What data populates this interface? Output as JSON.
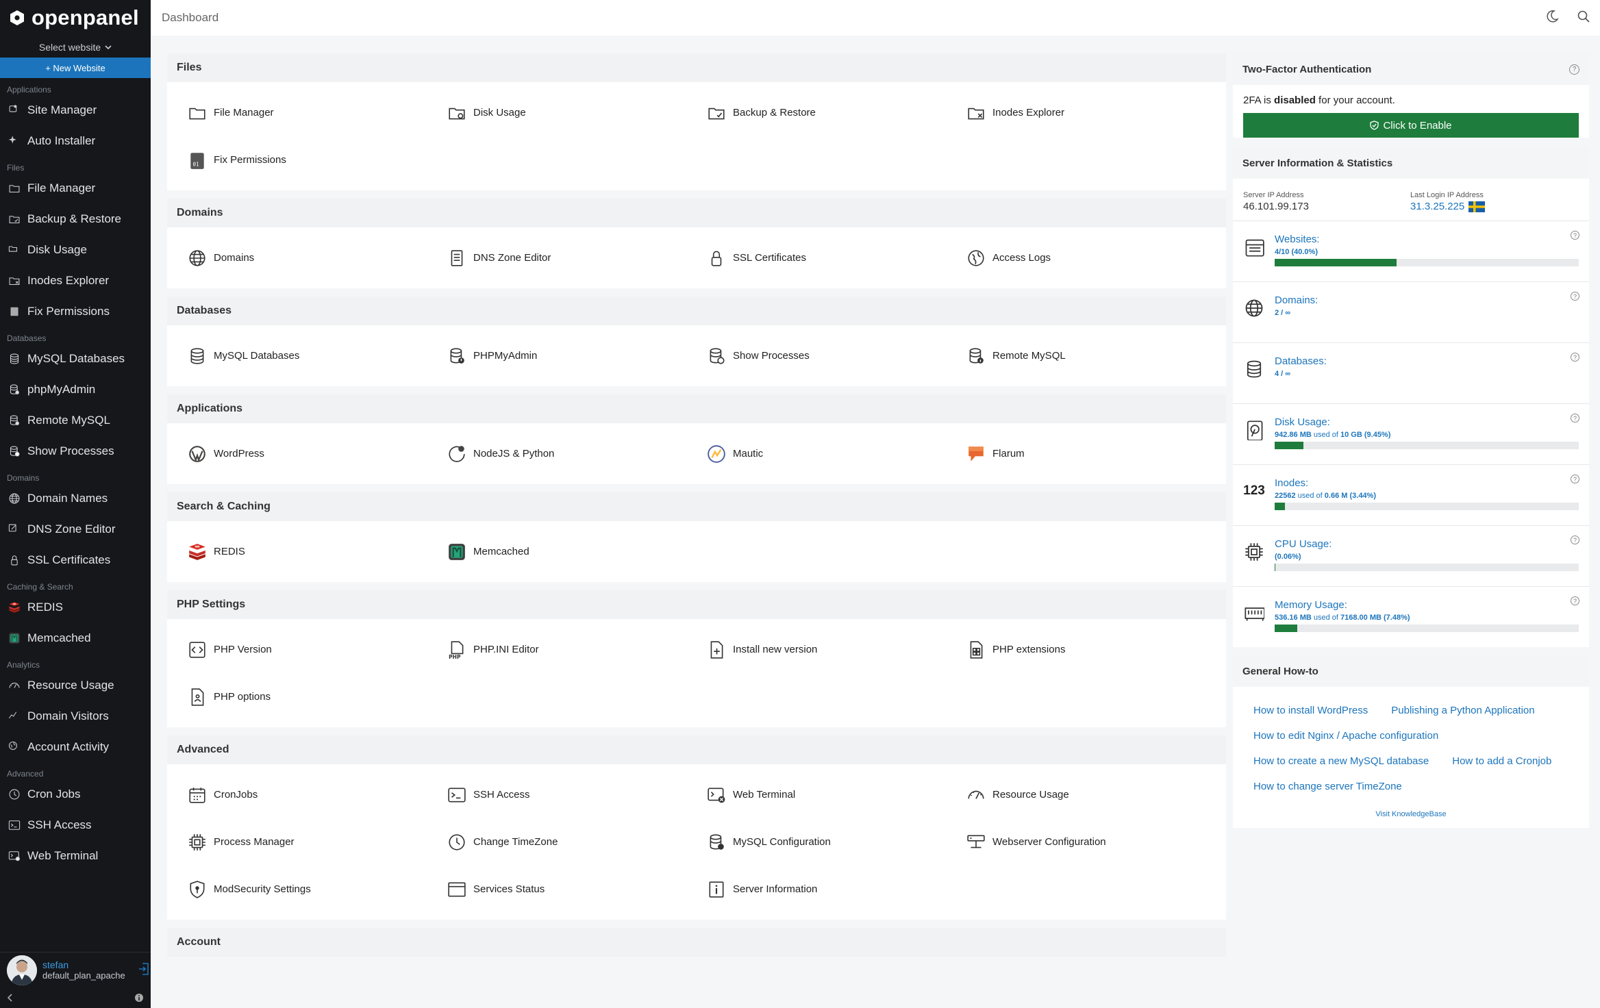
{
  "app": {
    "brand": "openpanel",
    "page_title": "Dashboard"
  },
  "sidebar": {
    "select_website": "Select website",
    "new_website": "+ New Website",
    "sections": [
      {
        "title": "Applications",
        "items": [
          {
            "label": "Site Manager",
            "icon": "site-icon"
          },
          {
            "label": "Auto Installer",
            "icon": "sparkle-icon"
          }
        ]
      },
      {
        "title": "Files",
        "items": [
          {
            "label": "File Manager",
            "icon": "folder-icon"
          },
          {
            "label": "Backup & Restore",
            "icon": "backup-icon"
          },
          {
            "label": "Disk Usage",
            "icon": "disk-icon"
          },
          {
            "label": "Inodes Explorer",
            "icon": "inodes-icon"
          },
          {
            "label": "Fix Permissions",
            "icon": "permissions-icon"
          }
        ]
      },
      {
        "title": "Databases",
        "items": [
          {
            "label": "MySQL Databases",
            "icon": "database-icon"
          },
          {
            "label": "phpMyAdmin",
            "icon": "phpmyadmin-icon"
          },
          {
            "label": "Remote MySQL",
            "icon": "remote-mysql-icon"
          },
          {
            "label": "Show Processes",
            "icon": "processes-icon"
          }
        ]
      },
      {
        "title": "Domains",
        "items": [
          {
            "label": "Domain Names",
            "icon": "globe-icon"
          },
          {
            "label": "DNS Zone Editor",
            "icon": "edit-icon"
          },
          {
            "label": "SSL Certificates",
            "icon": "lock-icon"
          }
        ]
      },
      {
        "title": "Caching & Search",
        "items": [
          {
            "label": "REDIS",
            "icon": "redis-icon"
          },
          {
            "label": "Memcached",
            "icon": "memcached-icon"
          }
        ]
      },
      {
        "title": "Analytics",
        "items": [
          {
            "label": "Resource Usage",
            "icon": "gauge-icon"
          },
          {
            "label": "Domain Visitors",
            "icon": "chart-icon"
          },
          {
            "label": "Account Activity",
            "icon": "activity-icon"
          }
        ]
      },
      {
        "title": "Advanced",
        "items": [
          {
            "label": "Cron Jobs",
            "icon": "clock-icon"
          },
          {
            "label": "SSH Access",
            "icon": "terminal-icon"
          },
          {
            "label": "Web Terminal",
            "icon": "web-terminal-icon"
          }
        ]
      }
    ],
    "user": {
      "name": "stefan",
      "plan": "default_plan_apache"
    }
  },
  "sections": [
    {
      "title": "Files",
      "tiles": [
        {
          "label": "File Manager",
          "icon": "folder-icon"
        },
        {
          "label": "Disk Usage",
          "icon": "disk-usage-icon"
        },
        {
          "label": "Backup & Restore",
          "icon": "backup-icon"
        },
        {
          "label": "Inodes Explorer",
          "icon": "inodes-icon"
        },
        {
          "label": "Fix Permissions",
          "icon": "fix-permissions-icon"
        }
      ]
    },
    {
      "title": "Domains",
      "tiles": [
        {
          "label": "Domains",
          "icon": "globe-icon"
        },
        {
          "label": "DNS Zone Editor",
          "icon": "dns-icon"
        },
        {
          "label": "SSL Certificates",
          "icon": "lock-icon"
        },
        {
          "label": "Access Logs",
          "icon": "access-logs-icon"
        }
      ]
    },
    {
      "title": "Databases",
      "tiles": [
        {
          "label": "MySQL Databases",
          "icon": "database-icon"
        },
        {
          "label": "PHPMyAdmin",
          "icon": "phpmyadmin-icon"
        },
        {
          "label": "Show Processes",
          "icon": "processes-icon"
        },
        {
          "label": "Remote MySQL",
          "icon": "remote-mysql-icon"
        }
      ]
    },
    {
      "title": "Applications",
      "tiles": [
        {
          "label": "WordPress",
          "icon": "wordpress-icon"
        },
        {
          "label": "NodeJS & Python",
          "icon": "nodejs-icon"
        },
        {
          "label": "Mautic",
          "icon": "mautic-icon"
        },
        {
          "label": "Flarum",
          "icon": "flarum-icon"
        }
      ]
    },
    {
      "title": "Search & Caching",
      "tiles": [
        {
          "label": "REDIS",
          "icon": "redis-icon"
        },
        {
          "label": "Memcached",
          "icon": "memcached-icon"
        }
      ]
    },
    {
      "title": "PHP Settings",
      "tiles": [
        {
          "label": "PHP Version",
          "icon": "code-icon"
        },
        {
          "label": "PHP.INI Editor",
          "icon": "php-ini-icon"
        },
        {
          "label": "Install new version",
          "icon": "install-icon"
        },
        {
          "label": "PHP extensions",
          "icon": "extensions-icon"
        },
        {
          "label": "PHP options",
          "icon": "options-icon"
        }
      ]
    },
    {
      "title": "Advanced",
      "tiles": [
        {
          "label": "CronJobs",
          "icon": "calendar-icon"
        },
        {
          "label": "SSH Access",
          "icon": "terminal-icon"
        },
        {
          "label": "Web Terminal",
          "icon": "web-terminal-icon"
        },
        {
          "label": "Resource Usage",
          "icon": "gauge-icon"
        },
        {
          "label": "Process Manager",
          "icon": "cpu-icon"
        },
        {
          "label": "Change TimeZone",
          "icon": "clock-icon"
        },
        {
          "label": "MySQL Configuration",
          "icon": "db-config-icon"
        },
        {
          "label": "Webserver Configuration",
          "icon": "server-config-icon"
        },
        {
          "label": "ModSecurity Settings",
          "icon": "shield-icon"
        },
        {
          "label": "Services Status",
          "icon": "services-icon"
        },
        {
          "label": "Server Information",
          "icon": "info-icon"
        }
      ]
    },
    {
      "title": "Account",
      "tiles": []
    }
  ],
  "two_factor": {
    "title": "Two-Factor Authentication",
    "text_prefix": "2FA is ",
    "text_status": "disabled",
    "text_suffix": " for your account.",
    "button": "Click to Enable"
  },
  "server_info": {
    "title": "Server Information & Statistics",
    "server_ip_label": "Server IP Address",
    "server_ip": "46.101.99.173",
    "last_login_label": "Last Login IP Address",
    "last_login_ip": "31.3.25.225",
    "last_login_flag": "sweden-flag-icon",
    "stats": [
      {
        "label": "Websites:",
        "value": "4/10 (40.0%)",
        "icon": "websites-icon",
        "percent": 40
      },
      {
        "label": "Domains:",
        "value": "2 / ∞",
        "icon": "globe-icon"
      },
      {
        "label": "Databases:",
        "value": "4 / ∞",
        "icon": "database-icon"
      },
      {
        "label": "Disk Usage:",
        "value": "942.86 MB",
        "mid": " used of ",
        "value2": "10 GB (9.45%)",
        "icon": "hdd-icon",
        "percent": 9.45
      },
      {
        "label": "Inodes:",
        "value": "22562",
        "mid": " used of ",
        "value2": "0.66 M (3.44%)",
        "icon": "inodes-count-icon",
        "icon_text": "123",
        "percent": 3.44
      },
      {
        "label": "CPU Usage:",
        "value": "(0.06%)",
        "icon": "cpu-icon",
        "percent": 0.06
      },
      {
        "label": "Memory Usage:",
        "value": "536.16 MB",
        "mid": " used of ",
        "value2": "7168.00 MB (7.48%)",
        "icon": "memory-icon",
        "percent": 7.48
      }
    ]
  },
  "howto": {
    "title": "General How-to",
    "links": [
      "How to install WordPress",
      "Publishing a Python Application",
      "How to edit Nginx / Apache configuration",
      "How to create a new MySQL database",
      "How to add a Cronjob",
      "How to change server TimeZone"
    ],
    "kb_link": "Visit KnowledgeBase"
  },
  "colors": {
    "sidebar_bg": "#15171b",
    "accent": "#1c75bc",
    "success": "#1e7d3c"
  }
}
